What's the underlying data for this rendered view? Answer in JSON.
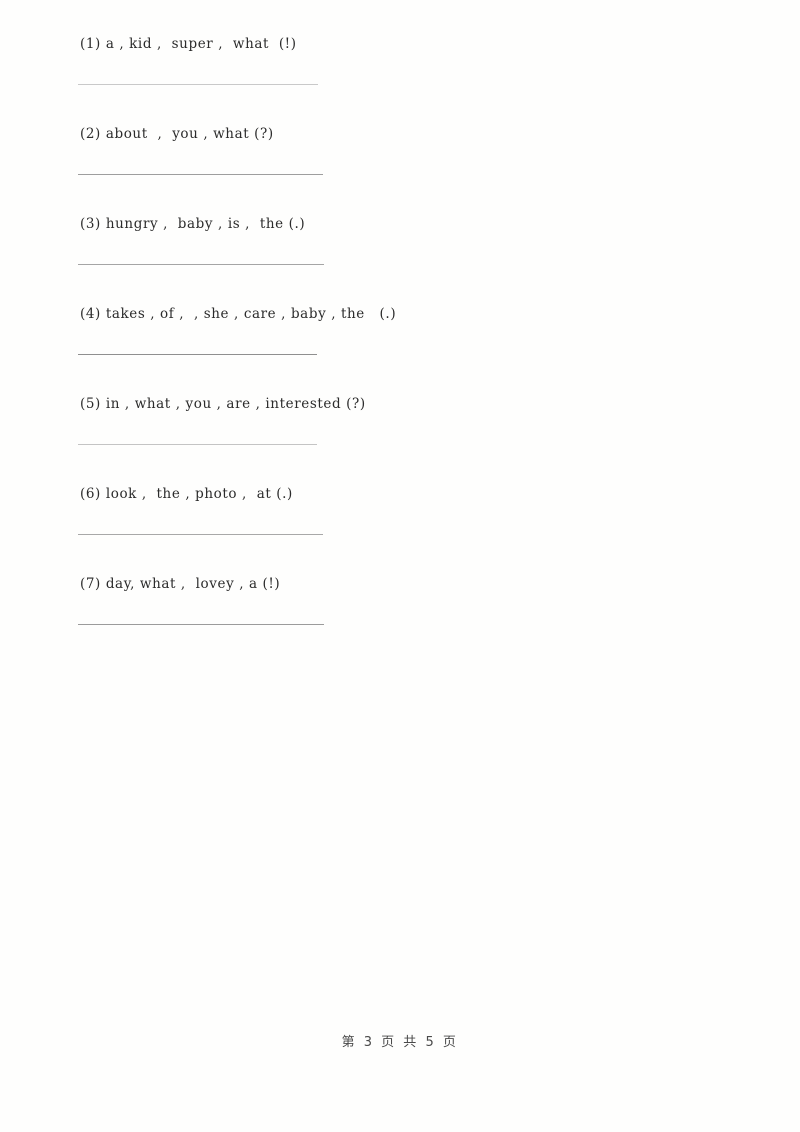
{
  "document": {
    "type": "worksheet",
    "background_color": "#fefefd",
    "text_color": "#2b2b2b",
    "rule_color": "#a8a8a8"
  },
  "exercises": [
    {
      "number": "(1)",
      "text": "(1) a , kid ,  super ,  what  (!)"
    },
    {
      "number": "(2)",
      "text": "(2) about  ,  you , what (?)"
    },
    {
      "number": "(3)",
      "text": "(3) hungry ,  baby , is ,  the (.)"
    },
    {
      "number": "(4)",
      "text": "(4) takes , of ,  , she , care , baby , the   (.)"
    },
    {
      "number": "(5)",
      "text": "(5) in , what , you , are , interested (?)"
    },
    {
      "number": "(6)",
      "text": "(6) look ,  the , photo ,  at (.)"
    },
    {
      "number": "(7)",
      "text": "(7) day, what ,  lovey , a (!)"
    }
  ],
  "footer": {
    "page_label": "第 3 页 共 5 页",
    "current_page": "3",
    "total_pages": "5"
  }
}
